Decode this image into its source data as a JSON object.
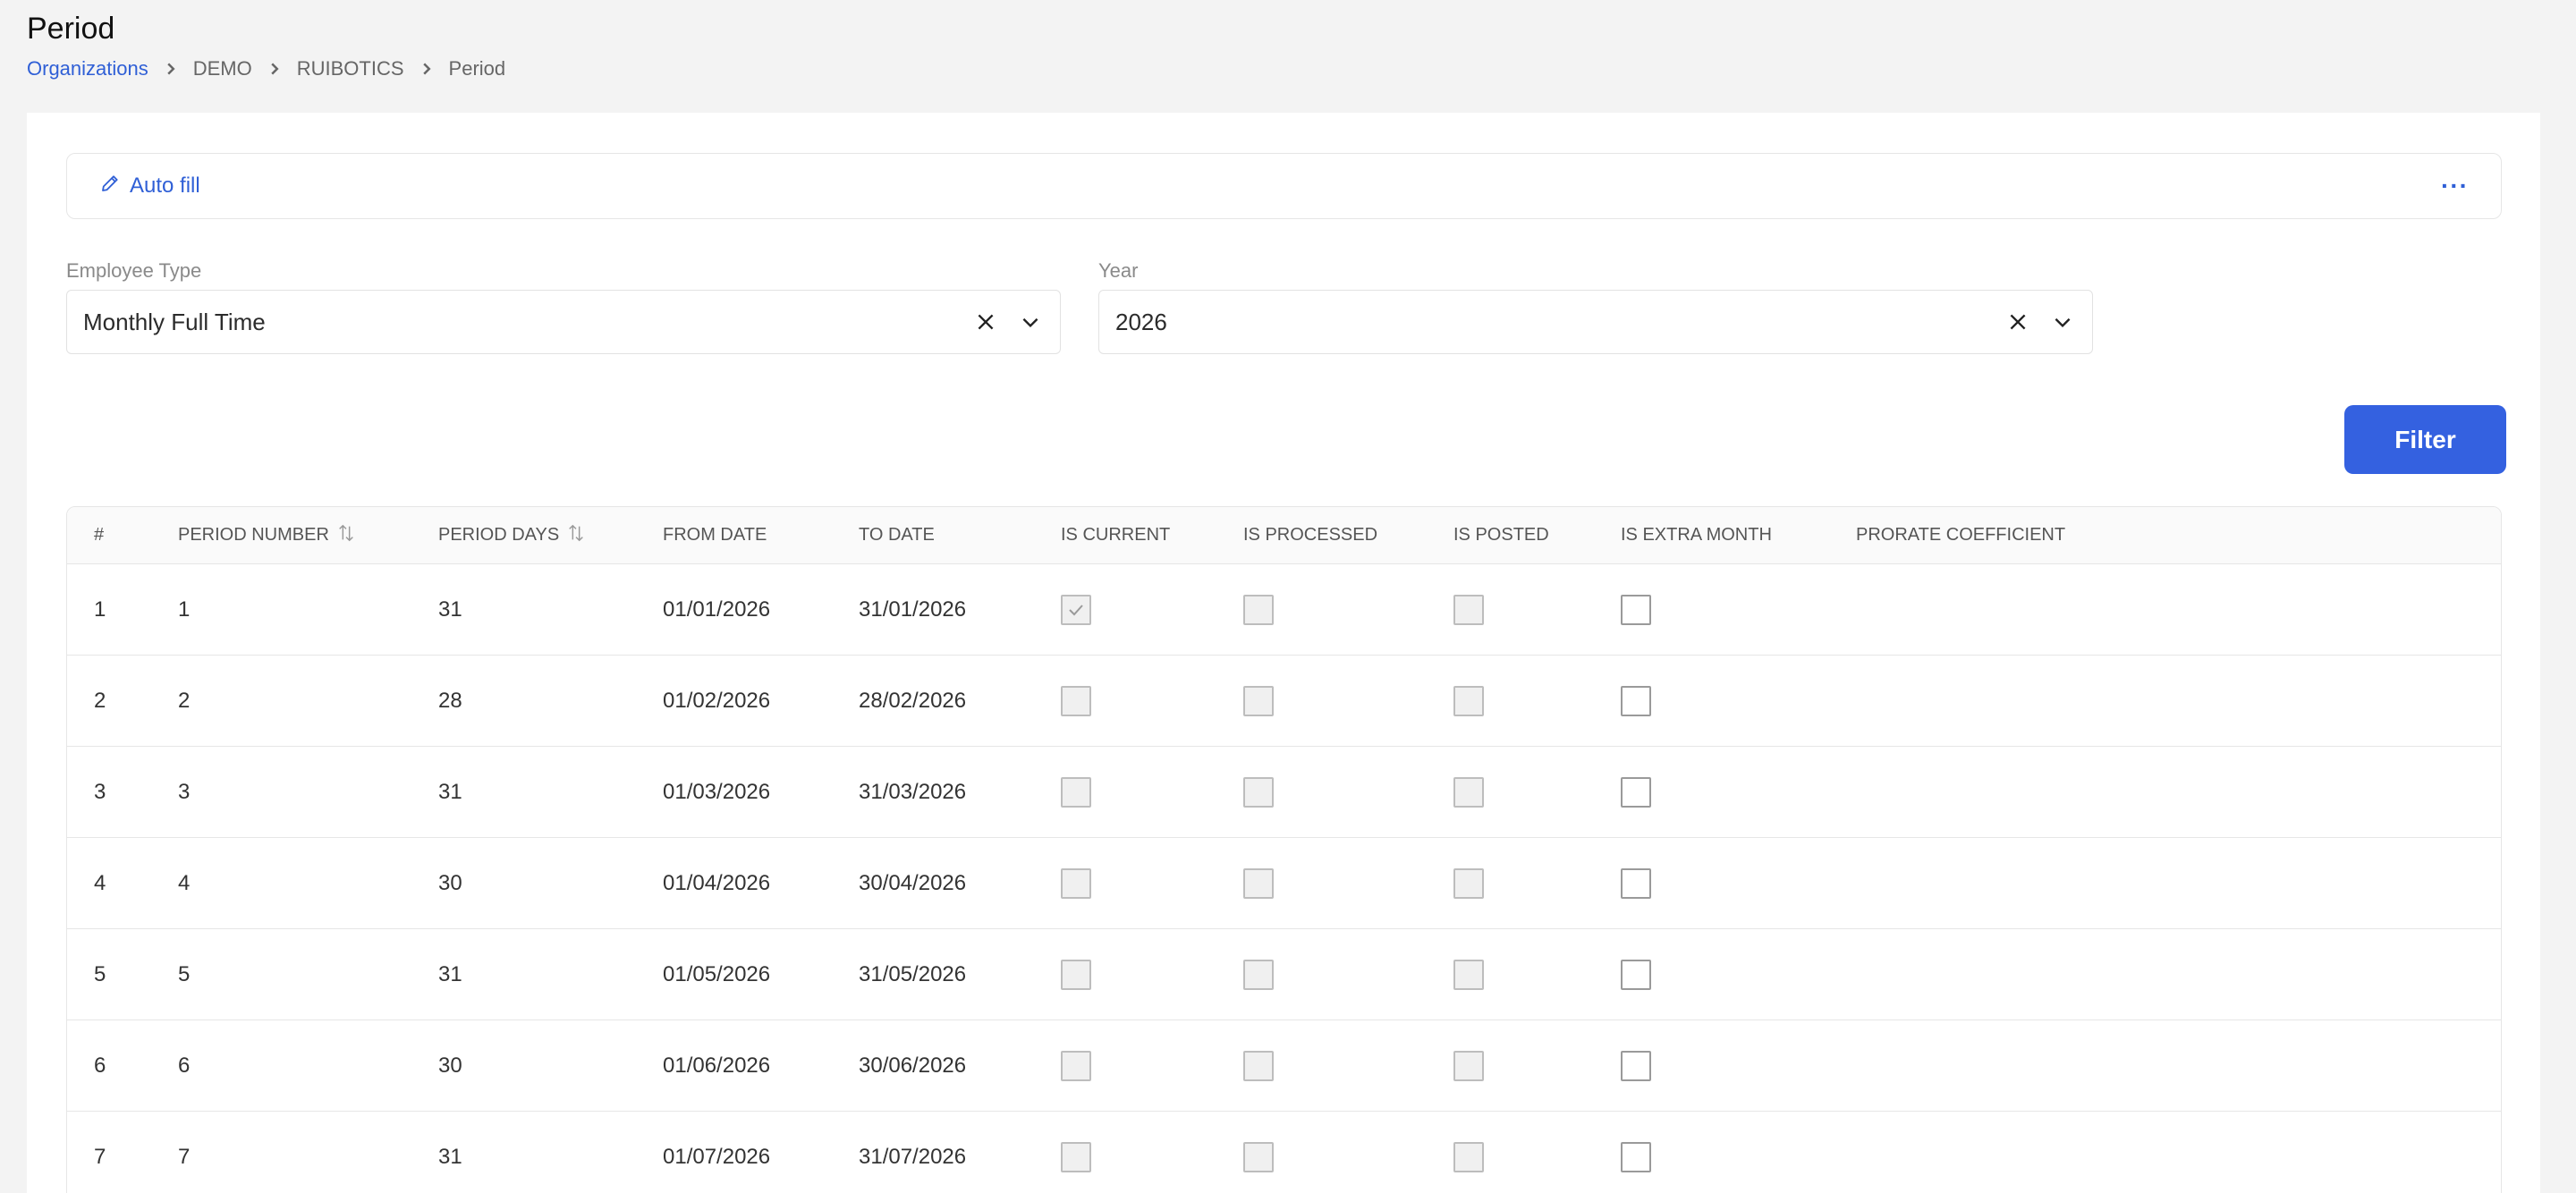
{
  "page": {
    "title": "Period"
  },
  "breadcrumb": [
    "Organizations",
    "DEMO",
    "RUIBOTICS",
    "Period"
  ],
  "toolbar": {
    "autofill_label": "Auto fill",
    "more_label": "···"
  },
  "filters": {
    "employee_type": {
      "label": "Employee Type",
      "value": "Monthly Full Time"
    },
    "year": {
      "label": "Year",
      "value": "2026"
    },
    "filter_label": "Filter"
  },
  "table": {
    "columns": [
      "#",
      "PERIOD NUMBER",
      "PERIOD DAYS",
      "FROM DATE",
      "TO DATE",
      "IS CURRENT",
      "IS PROCESSED",
      "IS POSTED",
      "IS EXTRA MONTH",
      "PRORATE COEFFICIENT"
    ],
    "rows": [
      {
        "index": "1",
        "period_number": "1",
        "period_days": "31",
        "from": "01/01/2026",
        "to": "31/01/2026",
        "is_current": true,
        "is_processed": false,
        "is_posted": false,
        "is_extra_month": false,
        "prorate": ""
      },
      {
        "index": "2",
        "period_number": "2",
        "period_days": "28",
        "from": "01/02/2026",
        "to": "28/02/2026",
        "is_current": false,
        "is_processed": false,
        "is_posted": false,
        "is_extra_month": false,
        "prorate": ""
      },
      {
        "index": "3",
        "period_number": "3",
        "period_days": "31",
        "from": "01/03/2026",
        "to": "31/03/2026",
        "is_current": false,
        "is_processed": false,
        "is_posted": false,
        "is_extra_month": false,
        "prorate": ""
      },
      {
        "index": "4",
        "period_number": "4",
        "period_days": "30",
        "from": "01/04/2026",
        "to": "30/04/2026",
        "is_current": false,
        "is_processed": false,
        "is_posted": false,
        "is_extra_month": false,
        "prorate": ""
      },
      {
        "index": "5",
        "period_number": "5",
        "period_days": "31",
        "from": "01/05/2026",
        "to": "31/05/2026",
        "is_current": false,
        "is_processed": false,
        "is_posted": false,
        "is_extra_month": false,
        "prorate": ""
      },
      {
        "index": "6",
        "period_number": "6",
        "period_days": "30",
        "from": "01/06/2026",
        "to": "30/06/2026",
        "is_current": false,
        "is_processed": false,
        "is_posted": false,
        "is_extra_month": false,
        "prorate": ""
      },
      {
        "index": "7",
        "period_number": "7",
        "period_days": "31",
        "from": "01/07/2026",
        "to": "31/07/2026",
        "is_current": false,
        "is_processed": false,
        "is_posted": false,
        "is_extra_month": false,
        "prorate": ""
      }
    ]
  },
  "colors": {
    "accent": "#3461e0",
    "link": "#2f5fd6"
  }
}
